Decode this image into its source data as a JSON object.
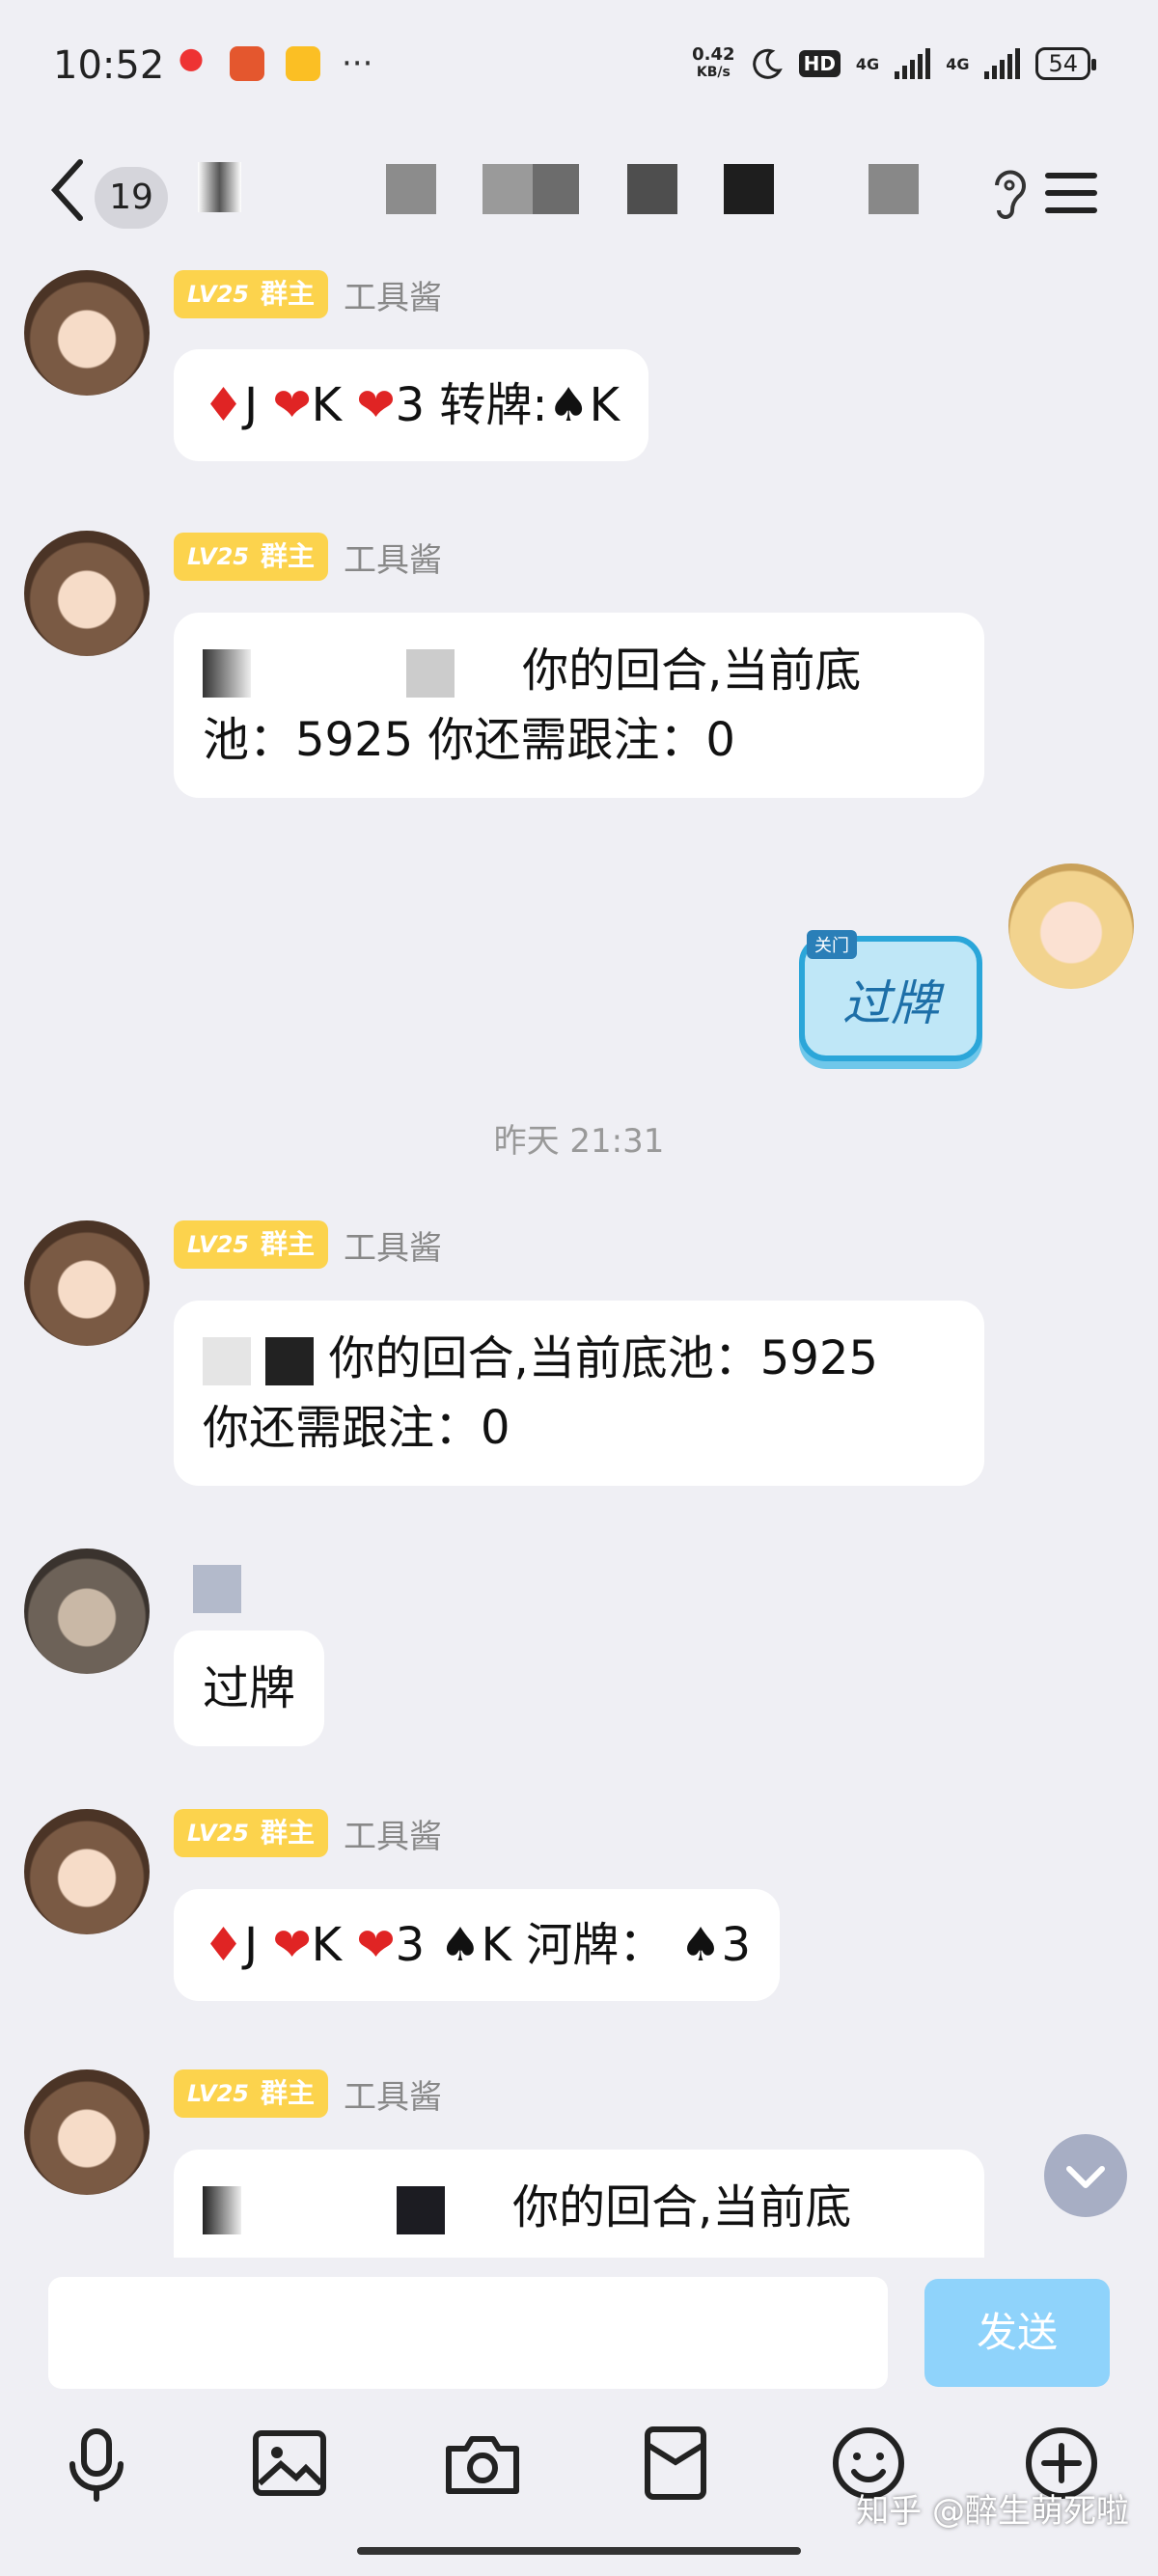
{
  "status_bar": {
    "time": "10:52",
    "dots": "···",
    "net_speed_value": "0.42",
    "net_speed_unit": "KB/s",
    "hd": "HD",
    "signal1": "4G",
    "signal2": "4G",
    "battery": "54"
  },
  "nav": {
    "unread_count": "19"
  },
  "messages": {
    "m1": {
      "badge_level": "LV25",
      "badge_role": "群主",
      "sender": "工具酱",
      "text": "♦J ❤K ❤3 转牌:♠K"
    },
    "m2": {
      "badge_level": "LV25",
      "badge_role": "群主",
      "sender": "工具酱",
      "line1": "你的回合,当前底",
      "line2": "池：5925 你还需跟注：0"
    },
    "m3": {
      "sticker_tag": "关门",
      "sticker_text": "过牌"
    },
    "timestamp": "昨天 21:31",
    "m4": {
      "badge_level": "LV25",
      "badge_role": "群主",
      "sender": "工具酱",
      "line1": "你的回合,当前底池：5925",
      "line2": "你还需跟注：0"
    },
    "m5": {
      "text": "过牌"
    },
    "m6": {
      "badge_level": "LV25",
      "badge_role": "群主",
      "sender": "工具酱",
      "text": "♦J ❤K ❤3 ♠K 河牌： ♠3"
    },
    "m7": {
      "badge_level": "LV25",
      "badge_role": "群主",
      "sender": "工具酱",
      "line1": "你的回合,当前底"
    }
  },
  "input": {
    "placeholder": "",
    "send_label": "发送"
  },
  "watermark": "知乎 @醉生萌死啦",
  "colors": {
    "background": "#efeff4",
    "badge": "#fcd34d",
    "send_button": "#8fd3fb",
    "sticker": "#bfe7f7"
  }
}
